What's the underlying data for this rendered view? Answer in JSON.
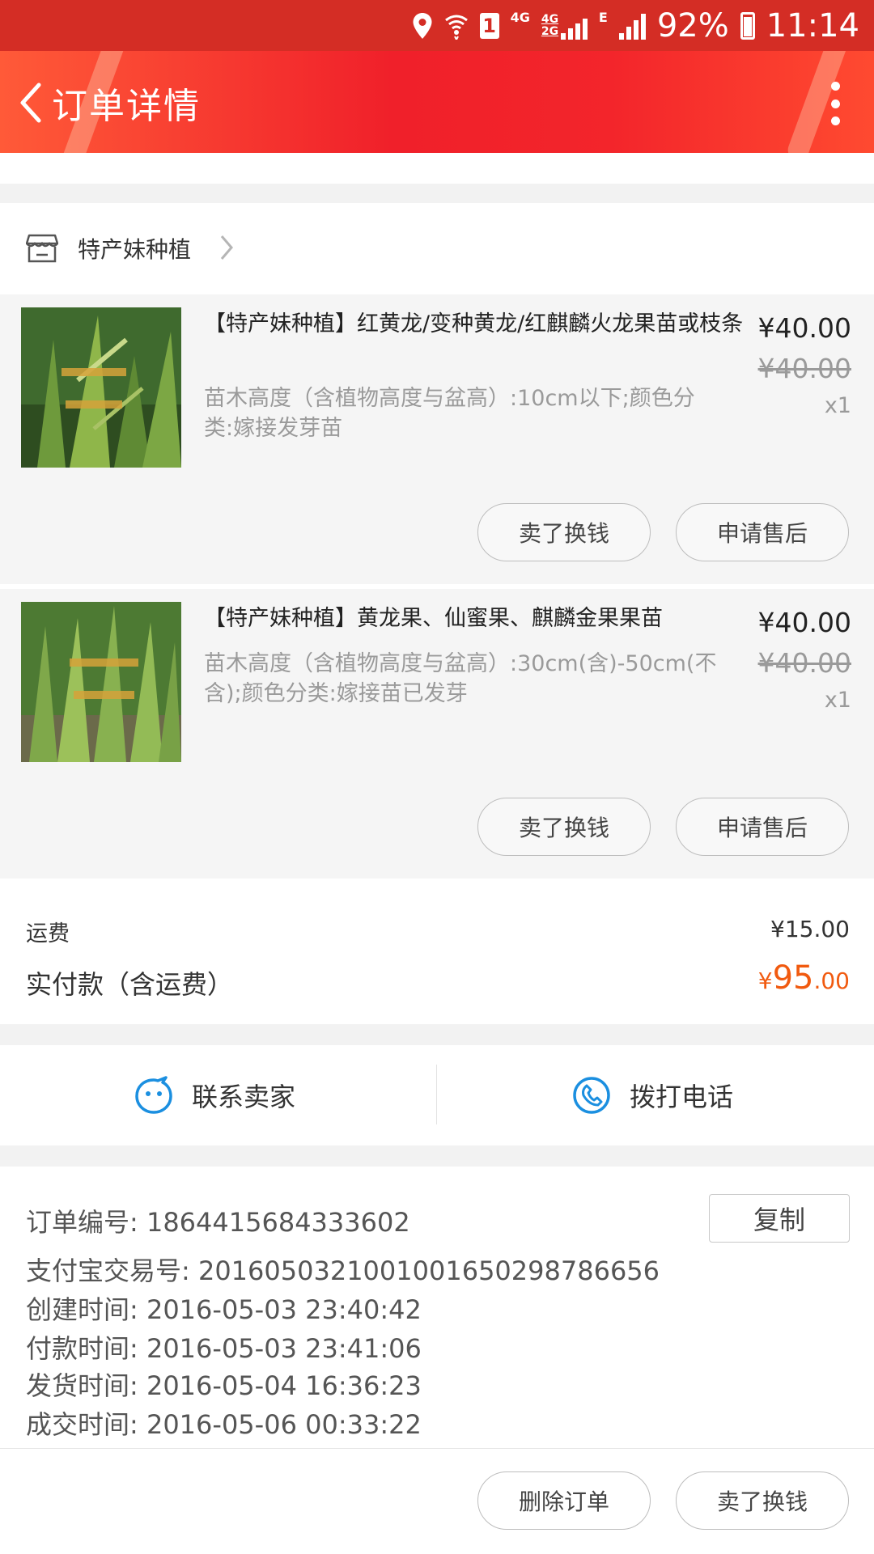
{
  "status_bar": {
    "battery": "92%",
    "time": "11:14",
    "sim_badge": "1",
    "network_4g": "4G",
    "network_4g_2g": "4G 2G",
    "network_e": "E"
  },
  "header": {
    "title": "订单详情"
  },
  "shop": {
    "name": "特产妹种植"
  },
  "items": [
    {
      "title": "【特产妹种植】红黄龙/变种黄龙/红麒麟火龙果苗或枝条",
      "spec": "苗木高度（含植物高度与盆高）:10cm以下;颜色分类:嫁接发芽苗",
      "price": "¥40.00",
      "original_price": "¥40.00",
      "quantity": "x1",
      "actions": [
        "卖了换钱",
        "申请售后"
      ]
    },
    {
      "title": "【特产妹种植】黄龙果、仙蜜果、麒麟金果果苗",
      "spec": "苗木高度（含植物高度与盆高）:30cm(含)-50cm(不含);颜色分类:嫁接苗已发芽",
      "price": "¥40.00",
      "original_price": "¥40.00",
      "quantity": "x1",
      "actions": [
        "卖了换钱",
        "申请售后"
      ]
    }
  ],
  "totals": {
    "shipping_label": "运费",
    "shipping_value": "¥15.00",
    "paid_label": "实付款（含运费）",
    "paid_currency": "¥",
    "paid_integer": "95",
    "paid_decimal": ".00",
    "accent_color": "#f15a0f"
  },
  "contact": {
    "chat_label": "联系卖家",
    "call_label": "拨打电话"
  },
  "order_info": {
    "copy_label": "复制",
    "lines": [
      "订单编号:  1864415684333602",
      "支付宝交易号:  2016050321001001650298786656",
      "创建时间:  2016-05-03 23:40:42",
      "付款时间:  2016-05-03 23:41:06",
      "发货时间:  2016-05-04 16:36:23",
      "成交时间:  2016-05-06 00:33:22"
    ]
  },
  "bottom_actions": {
    "delete_label": "删除订单",
    "resell_label": "卖了换钱"
  }
}
